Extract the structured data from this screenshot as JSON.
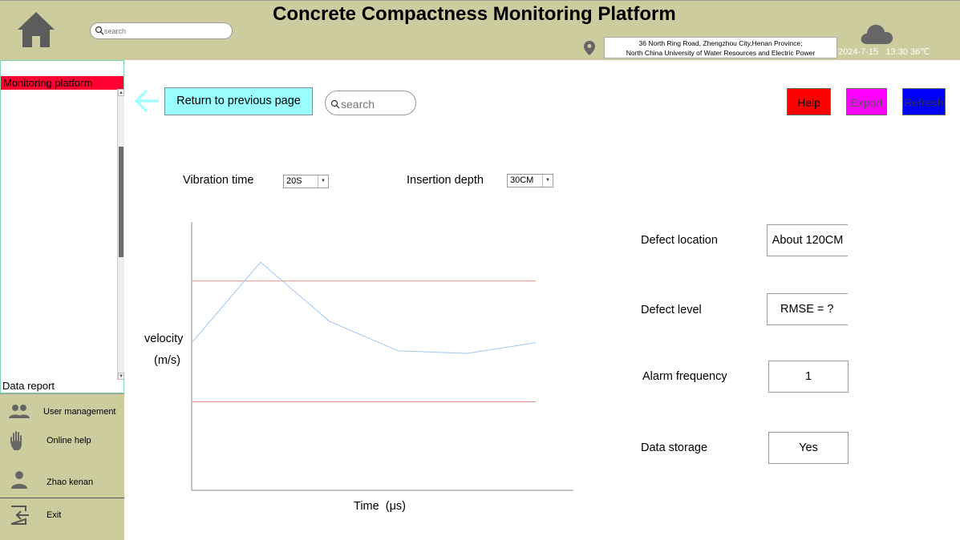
{
  "header": {
    "title": "Concrete Compactness Monitoring Platform",
    "search_placeholder": "search",
    "address_line1": "36 North Ring Road, Zhengzhou City,Henan Province;",
    "address_line2": "North China University of Water Resources and Electric Power",
    "date": "2024-7-15",
    "time_temp": "13:30 36℃",
    "icons": [
      "home-icon",
      "search-icon",
      "location-pin-icon",
      "cloud-icon"
    ]
  },
  "sidebar": {
    "active_item": "Monitoring platform",
    "data_report": "Data report",
    "menu": [
      {
        "label": "User management",
        "icon": "users-icon"
      },
      {
        "label": "Online help",
        "icon": "hand-icon"
      },
      {
        "label": "Zhao kenan",
        "icon": "user-icon"
      },
      {
        "label": "Exit",
        "icon": "exit-icon"
      }
    ]
  },
  "toolbar": {
    "back_label": "Return to previous page",
    "search_placeholder": "search",
    "help_label": "Help",
    "export_label": "Export",
    "refresh_label": "Refresh"
  },
  "params": {
    "vibration_label": "Vibration time",
    "vibration_value": "20S",
    "depth_label": "Insertion depth",
    "depth_value": "30CM"
  },
  "chart_data": {
    "type": "line",
    "ylabel_line1": "velocity",
    "ylabel_line2": "(m/s)",
    "xlabel": "Time  (μs)",
    "series": [
      {
        "color": "#9cc6ee",
        "values": [
          0.55,
          0.85,
          0.63,
          0.52,
          0.51,
          0.55
        ]
      }
    ],
    "thresholds": [
      {
        "value": 0.78,
        "color": "#f28a8a"
      },
      {
        "value": 0.33,
        "color": "#f28a8a"
      }
    ],
    "ylim": [
      0,
      1
    ],
    "grid": false
  },
  "info": {
    "defect_location_label": "Defect location",
    "defect_location_value": "About 120CM",
    "defect_level_label": "Defect level",
    "defect_level_value": "RMSE = ?",
    "alarm_frequency_label": "Alarm frequency",
    "alarm_frequency_value": "1",
    "data_storage_label": "Data storage",
    "data_storage_value": "Yes"
  },
  "colors": {
    "header_bg": "#cccc9e",
    "active_item": "#ff0033",
    "back_button": "#99ffff",
    "help": "#ff0000",
    "export": "#ff00ff",
    "refresh": "#0000ff"
  }
}
